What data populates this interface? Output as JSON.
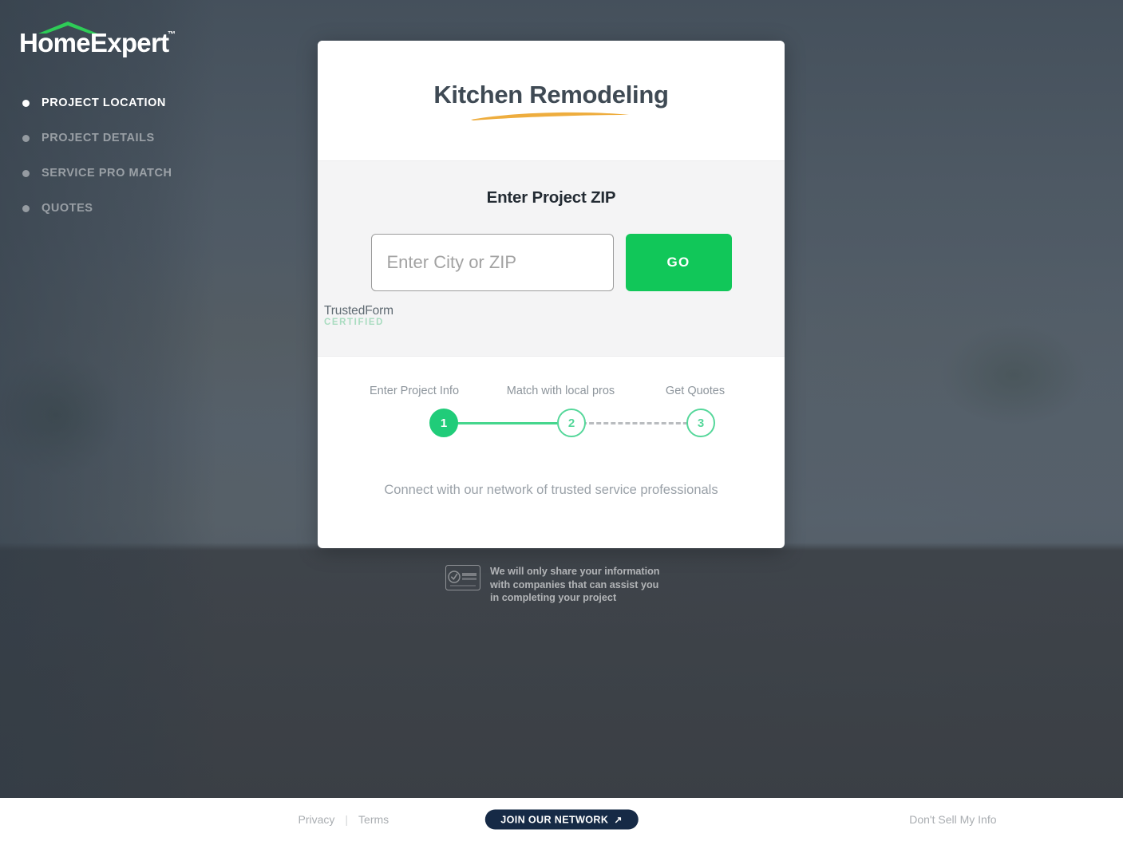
{
  "brand": {
    "name": "HomeExpert",
    "trademark": "™",
    "roof_color": "#2ecc57",
    "logo_text_color": "#ffffff"
  },
  "sidenav": {
    "items": [
      {
        "label": "PROJECT LOCATION",
        "active": true
      },
      {
        "label": "PROJECT DETAILS",
        "active": false
      },
      {
        "label": "SERVICE PRO MATCH",
        "active": false
      },
      {
        "label": "QUOTES",
        "active": false
      }
    ]
  },
  "modal": {
    "title": "Kitchen Remodeling",
    "accent_color": "#eead3e",
    "form": {
      "heading": "Enter Project ZIP",
      "zip_value": "",
      "zip_placeholder": "Enter City or ZIP",
      "submit_label": "GO",
      "submit_color": "#11c759"
    },
    "trustedform": {
      "name": "TrustedForm",
      "certified": "CERTIFIED",
      "icon": "document-check-icon"
    },
    "progress": {
      "steps": [
        {
          "number": "1",
          "label": "Enter Project Info",
          "state": "done"
        },
        {
          "number": "2",
          "label": "Match with local pros",
          "state": "upcoming"
        },
        {
          "number": "3",
          "label": "Get Quotes",
          "state": "upcoming"
        }
      ],
      "active_color": "#20cc79",
      "track_color": "#45d68d",
      "pending_track_color": "#b9bcbf"
    },
    "footnote": "Connect with our network of trusted service professionals"
  },
  "disclaimer": {
    "seal": "norton-secured-seal",
    "line1": "We will only share your information",
    "line2": "with companies that can assist you",
    "line3": "in completing your project"
  },
  "footer": {
    "privacy": "Privacy",
    "separator": "|",
    "terms": "Terms",
    "join_label": "JOIN OUR NETWORK",
    "join_arrow": "↗",
    "join_color": "#162a46",
    "do_not_sell": "Don't Sell My Info"
  }
}
